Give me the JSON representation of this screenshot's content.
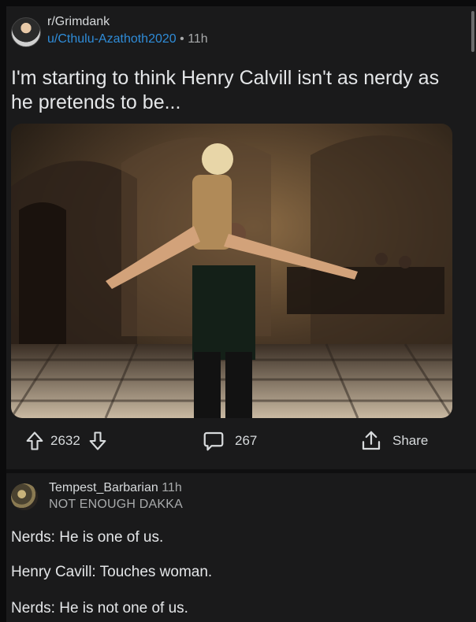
{
  "post": {
    "subreddit": "r/Grimdank",
    "author": "u/Cthulu-Azathoth2020",
    "separator": "•",
    "time": "11h",
    "title": "I'm starting to think Henry Calvill isn't as nerdy as he pretends to be..."
  },
  "actions": {
    "upvotes": "2632",
    "comments": "267",
    "share_label": "Share"
  },
  "comment": {
    "author": "Tempest_Barbarian",
    "time": "11h",
    "flair": "NOT ENOUGH DAKKA",
    "lines": [
      "Nerds: He is one of us.",
      "Henry Cavill: Touches woman.",
      "Nerds: He is not one of us."
    ]
  },
  "icons": {
    "upvote": "arrow-up-icon",
    "downvote": "arrow-down-icon",
    "comments": "speech-bubble-icon",
    "share": "share-icon"
  },
  "colors": {
    "background": "#1a1a1b",
    "username": "#2f8cd8",
    "text": "#d7dadc",
    "muted": "#a8aaab"
  }
}
